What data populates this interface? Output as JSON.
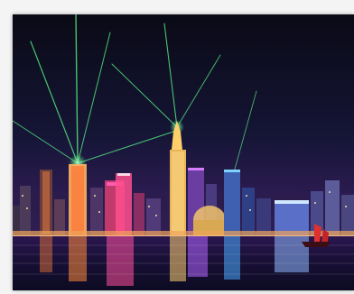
{
  "image": {
    "subject": "",
    "colors": {
      "sky_top": "#0b0b18",
      "sky_mid": "#141436",
      "sky_horizon": "#3a1f5a",
      "water_dark": "#0d0c24",
      "laser": "#4dff7a",
      "neon_pink": "#ff3fa4",
      "neon_blue": "#4aa9ff",
      "neon_orange": "#ff9a3a",
      "frame": "#f4f4f4"
    }
  }
}
